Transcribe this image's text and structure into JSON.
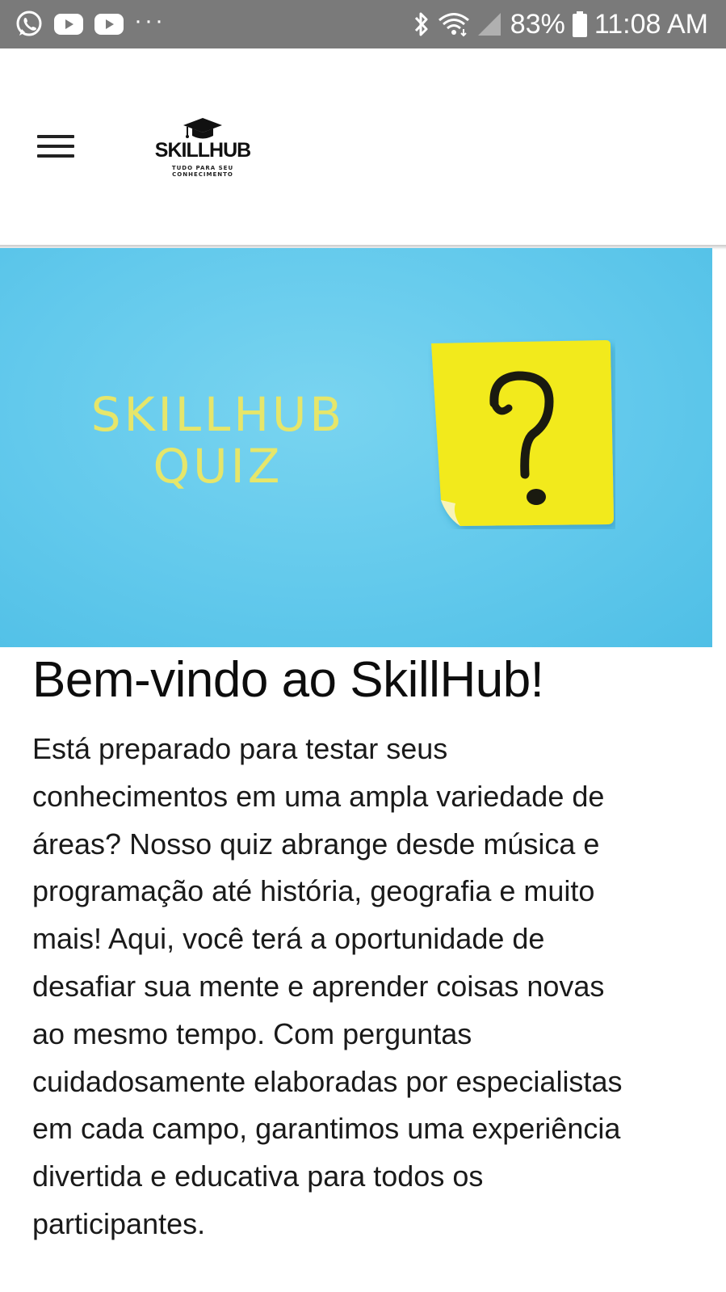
{
  "status_bar": {
    "left_icons": [
      "whatsapp-icon",
      "youtube-icon",
      "youtube-icon",
      "more-dots-icon"
    ],
    "more_dots": "···",
    "right_icons": [
      "bluetooth-icon",
      "wifi-icon",
      "signal-icon",
      "battery-icon"
    ],
    "battery_percent": "83%",
    "time": "11:08 AM"
  },
  "header": {
    "menu_icon": "hamburger-menu-icon",
    "logo": {
      "wordmark": "SKILLHUB",
      "tagline_line1": "TUDO PARA SEU",
      "tagline_line2": "CONHECIMENTO",
      "icon": "graduation-cap-icon"
    }
  },
  "hero": {
    "title_line1": "SKILLHUB",
    "title_line2": "QUIZ",
    "image": "question-mark-sticky-note",
    "colors": {
      "background": "#62c9ec",
      "title": "#e6e66a",
      "note": "#f2ea1a"
    }
  },
  "main": {
    "title": "Bem-vindo ao SkillHub!",
    "paragraph": "Está preparado para testar seus\nconhecimentos em uma ampla variedade de\náreas? Nosso quiz abrange desde música e\nprogramação até história, geografia e muito\nmais! Aqui, você terá a oportunidade de\ndesafiar sua mente e aprender coisas novas\nao mesmo tempo. Com perguntas\ncuidadosamente elaboradas por especialistas\nem cada campo, garantimos uma experiência\ndivertida e educativa para todos os\nparticipantes."
  }
}
